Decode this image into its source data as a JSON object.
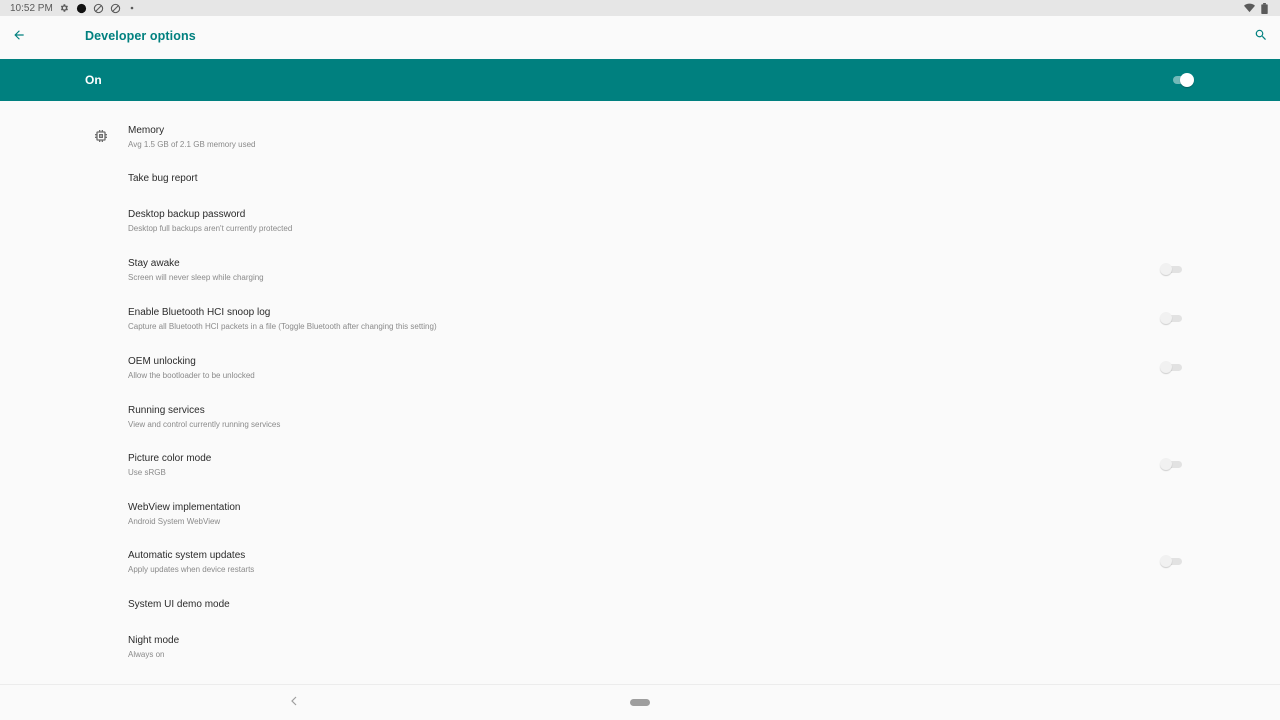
{
  "status_bar": {
    "time": "10:52 PM",
    "left_icons": [
      "settings-icon",
      "record-icon",
      "no-sim-icon",
      "no-sim-icon",
      "dot-icon"
    ],
    "right_icons": [
      "wifi-icon",
      "battery-icon"
    ]
  },
  "toolbar": {
    "back_icon": "arrow-back-icon",
    "title": "Developer options",
    "search_icon": "search-icon"
  },
  "master_switch": {
    "label": "On",
    "checked": true
  },
  "settings": {
    "items": [
      {
        "title": "Memory",
        "summary": "Avg 1.5 GB of 2.1 GB memory used",
        "icon": "memory-chip-icon"
      },
      {
        "title": "Take bug report",
        "summary": ""
      },
      {
        "title": "Desktop backup password",
        "summary": "Desktop full backups aren't currently protected"
      },
      {
        "title": "Stay awake",
        "summary": "Screen will never sleep while charging",
        "switch": false
      },
      {
        "title": "Enable Bluetooth HCI snoop log",
        "summary": "Capture all Bluetooth HCI packets in a file (Toggle Bluetooth after changing this setting)",
        "switch": false
      },
      {
        "title": "OEM unlocking",
        "summary": "Allow the bootloader to be unlocked",
        "switch": false
      },
      {
        "title": "Running services",
        "summary": "View and control currently running services"
      },
      {
        "title": "Picture color mode",
        "summary": "Use sRGB",
        "switch": false
      },
      {
        "title": "WebView implementation",
        "summary": "Android System WebView"
      },
      {
        "title": "Automatic system updates",
        "summary": "Apply updates when device restarts",
        "switch": false
      },
      {
        "title": "System UI demo mode",
        "summary": ""
      },
      {
        "title": "Night mode",
        "summary": "Always on"
      }
    ]
  },
  "nav_bar": {
    "back_icon": "nav-back-icon",
    "home_icon": "nav-home-pill-icon"
  },
  "colors": {
    "accent": "#00807f",
    "background": "#fafafa",
    "status_bar": "#e6e6e6"
  }
}
